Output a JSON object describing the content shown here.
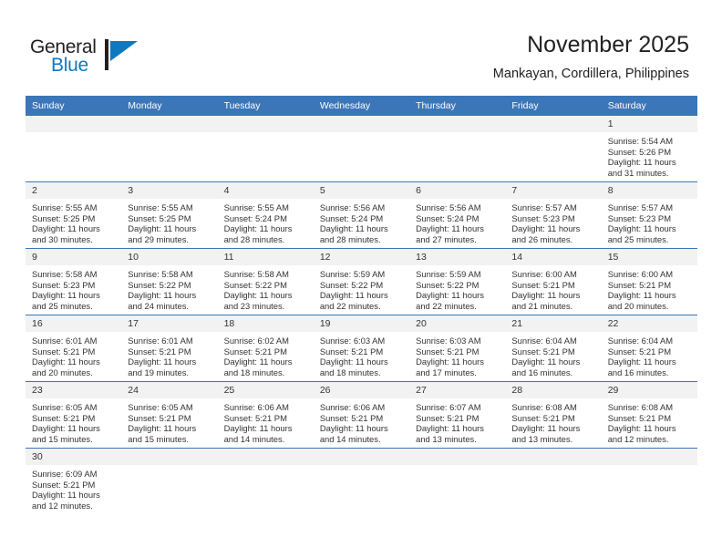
{
  "branding": {
    "name_part1": "General",
    "name_part2": "Blue",
    "mark_icon": "triangle-flag-icon",
    "accent_color": "#1278be"
  },
  "header": {
    "title": "November 2025",
    "subtitle": "Mankayan, Cordillera, Philippines"
  },
  "theme": {
    "header_blue": "#3b76b8",
    "daynum_band": "#f2f2f2",
    "text": "#333333"
  },
  "calendar": {
    "weekday_headers": [
      "Sunday",
      "Monday",
      "Tuesday",
      "Wednesday",
      "Thursday",
      "Friday",
      "Saturday"
    ],
    "weeks": [
      [
        {
          "day": "",
          "lines": []
        },
        {
          "day": "",
          "lines": []
        },
        {
          "day": "",
          "lines": []
        },
        {
          "day": "",
          "lines": []
        },
        {
          "day": "",
          "lines": []
        },
        {
          "day": "",
          "lines": []
        },
        {
          "day": "1",
          "lines": [
            "Sunrise: 5:54 AM",
            "Sunset: 5:26 PM",
            "Daylight: 11 hours",
            "and 31 minutes."
          ]
        }
      ],
      [
        {
          "day": "2",
          "lines": [
            "Sunrise: 5:55 AM",
            "Sunset: 5:25 PM",
            "Daylight: 11 hours",
            "and 30 minutes."
          ]
        },
        {
          "day": "3",
          "lines": [
            "Sunrise: 5:55 AM",
            "Sunset: 5:25 PM",
            "Daylight: 11 hours",
            "and 29 minutes."
          ]
        },
        {
          "day": "4",
          "lines": [
            "Sunrise: 5:55 AM",
            "Sunset: 5:24 PM",
            "Daylight: 11 hours",
            "and 28 minutes."
          ]
        },
        {
          "day": "5",
          "lines": [
            "Sunrise: 5:56 AM",
            "Sunset: 5:24 PM",
            "Daylight: 11 hours",
            "and 28 minutes."
          ]
        },
        {
          "day": "6",
          "lines": [
            "Sunrise: 5:56 AM",
            "Sunset: 5:24 PM",
            "Daylight: 11 hours",
            "and 27 minutes."
          ]
        },
        {
          "day": "7",
          "lines": [
            "Sunrise: 5:57 AM",
            "Sunset: 5:23 PM",
            "Daylight: 11 hours",
            "and 26 minutes."
          ]
        },
        {
          "day": "8",
          "lines": [
            "Sunrise: 5:57 AM",
            "Sunset: 5:23 PM",
            "Daylight: 11 hours",
            "and 25 minutes."
          ]
        }
      ],
      [
        {
          "day": "9",
          "lines": [
            "Sunrise: 5:58 AM",
            "Sunset: 5:23 PM",
            "Daylight: 11 hours",
            "and 25 minutes."
          ]
        },
        {
          "day": "10",
          "lines": [
            "Sunrise: 5:58 AM",
            "Sunset: 5:22 PM",
            "Daylight: 11 hours",
            "and 24 minutes."
          ]
        },
        {
          "day": "11",
          "lines": [
            "Sunrise: 5:58 AM",
            "Sunset: 5:22 PM",
            "Daylight: 11 hours",
            "and 23 minutes."
          ]
        },
        {
          "day": "12",
          "lines": [
            "Sunrise: 5:59 AM",
            "Sunset: 5:22 PM",
            "Daylight: 11 hours",
            "and 22 minutes."
          ]
        },
        {
          "day": "13",
          "lines": [
            "Sunrise: 5:59 AM",
            "Sunset: 5:22 PM",
            "Daylight: 11 hours",
            "and 22 minutes."
          ]
        },
        {
          "day": "14",
          "lines": [
            "Sunrise: 6:00 AM",
            "Sunset: 5:21 PM",
            "Daylight: 11 hours",
            "and 21 minutes."
          ]
        },
        {
          "day": "15",
          "lines": [
            "Sunrise: 6:00 AM",
            "Sunset: 5:21 PM",
            "Daylight: 11 hours",
            "and 20 minutes."
          ]
        }
      ],
      [
        {
          "day": "16",
          "lines": [
            "Sunrise: 6:01 AM",
            "Sunset: 5:21 PM",
            "Daylight: 11 hours",
            "and 20 minutes."
          ]
        },
        {
          "day": "17",
          "lines": [
            "Sunrise: 6:01 AM",
            "Sunset: 5:21 PM",
            "Daylight: 11 hours",
            "and 19 minutes."
          ]
        },
        {
          "day": "18",
          "lines": [
            "Sunrise: 6:02 AM",
            "Sunset: 5:21 PM",
            "Daylight: 11 hours",
            "and 18 minutes."
          ]
        },
        {
          "day": "19",
          "lines": [
            "Sunrise: 6:03 AM",
            "Sunset: 5:21 PM",
            "Daylight: 11 hours",
            "and 18 minutes."
          ]
        },
        {
          "day": "20",
          "lines": [
            "Sunrise: 6:03 AM",
            "Sunset: 5:21 PM",
            "Daylight: 11 hours",
            "and 17 minutes."
          ]
        },
        {
          "day": "21",
          "lines": [
            "Sunrise: 6:04 AM",
            "Sunset: 5:21 PM",
            "Daylight: 11 hours",
            "and 16 minutes."
          ]
        },
        {
          "day": "22",
          "lines": [
            "Sunrise: 6:04 AM",
            "Sunset: 5:21 PM",
            "Daylight: 11 hours",
            "and 16 minutes."
          ]
        }
      ],
      [
        {
          "day": "23",
          "lines": [
            "Sunrise: 6:05 AM",
            "Sunset: 5:21 PM",
            "Daylight: 11 hours",
            "and 15 minutes."
          ]
        },
        {
          "day": "24",
          "lines": [
            "Sunrise: 6:05 AM",
            "Sunset: 5:21 PM",
            "Daylight: 11 hours",
            "and 15 minutes."
          ]
        },
        {
          "day": "25",
          "lines": [
            "Sunrise: 6:06 AM",
            "Sunset: 5:21 PM",
            "Daylight: 11 hours",
            "and 14 minutes."
          ]
        },
        {
          "day": "26",
          "lines": [
            "Sunrise: 6:06 AM",
            "Sunset: 5:21 PM",
            "Daylight: 11 hours",
            "and 14 minutes."
          ]
        },
        {
          "day": "27",
          "lines": [
            "Sunrise: 6:07 AM",
            "Sunset: 5:21 PM",
            "Daylight: 11 hours",
            "and 13 minutes."
          ]
        },
        {
          "day": "28",
          "lines": [
            "Sunrise: 6:08 AM",
            "Sunset: 5:21 PM",
            "Daylight: 11 hours",
            "and 13 minutes."
          ]
        },
        {
          "day": "29",
          "lines": [
            "Sunrise: 6:08 AM",
            "Sunset: 5:21 PM",
            "Daylight: 11 hours",
            "and 12 minutes."
          ]
        }
      ],
      [
        {
          "day": "30",
          "lines": [
            "Sunrise: 6:09 AM",
            "Sunset: 5:21 PM",
            "Daylight: 11 hours",
            "and 12 minutes."
          ]
        },
        {
          "day": "",
          "lines": []
        },
        {
          "day": "",
          "lines": []
        },
        {
          "day": "",
          "lines": []
        },
        {
          "day": "",
          "lines": []
        },
        {
          "day": "",
          "lines": []
        },
        {
          "day": "",
          "lines": []
        }
      ]
    ]
  }
}
